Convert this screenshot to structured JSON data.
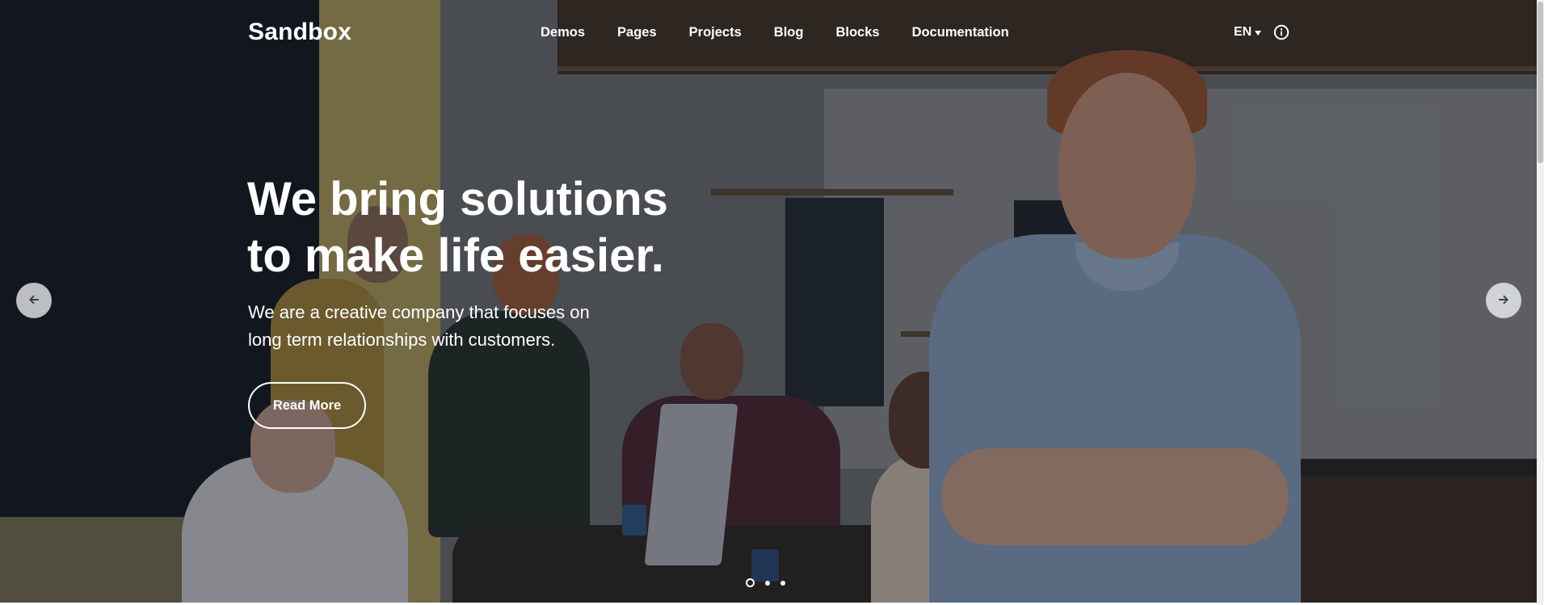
{
  "header": {
    "logo": "Sandbox",
    "nav": [
      "Demos",
      "Pages",
      "Projects",
      "Blog",
      "Blocks",
      "Documentation"
    ],
    "language": "EN",
    "language_icon": "chevron-down-icon",
    "info_icon": "info-icon"
  },
  "hero": {
    "headline_lines": [
      "We bring solutions",
      "to make life easier."
    ],
    "lead_lines": [
      "We are a creative company that focuses on",
      "long term relationships with customers."
    ],
    "cta_label": "Read More",
    "prev_icon": "arrow-left-icon",
    "next_icon": "arrow-right-icon",
    "slides_total": 3,
    "active_slide": 1
  },
  "colors": {
    "text": "#ffffff",
    "arrow_bg": "#ffffff",
    "arrow_icon": "#343f52",
    "scrollbar_thumb": "#c1c1c1"
  }
}
